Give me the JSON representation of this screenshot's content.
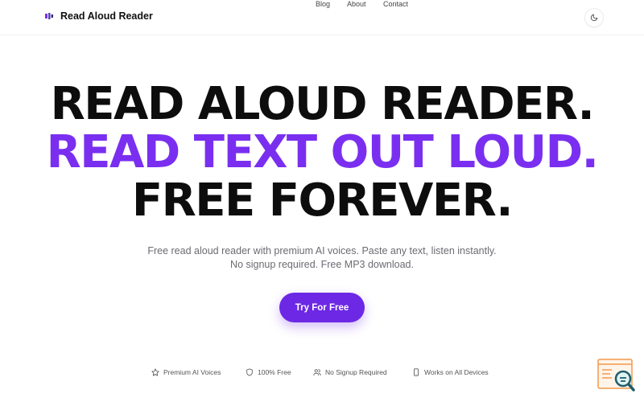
{
  "header": {
    "brand": "Read Aloud Reader",
    "nav": [
      {
        "label": "Blog"
      },
      {
        "label": "About"
      },
      {
        "label": "Contact"
      }
    ],
    "theme_icon": "moon-icon"
  },
  "hero": {
    "line1": "READ ALOUD READER.",
    "line2": "READ TEXT OUT LOUD.",
    "line3": "FREE FOREVER.",
    "subtitle": "Free read aloud reader with premium AI voices. Paste any text, listen instantly. No signup required. Free MP3 download.",
    "cta_label": "Try For Free"
  },
  "features": [
    {
      "label": "Premium AI Voices",
      "icon": "star-icon"
    },
    {
      "label": "100% Free",
      "icon": "shield-icon"
    },
    {
      "label": "No Signup Required",
      "icon": "users-icon"
    },
    {
      "label": "Works on All Devices",
      "icon": "smartphone-icon"
    }
  ],
  "colors": {
    "accent": "#7a2ff0",
    "cta": "#6d28e6",
    "text": "#0d0d0d",
    "muted": "#6b6b72"
  }
}
